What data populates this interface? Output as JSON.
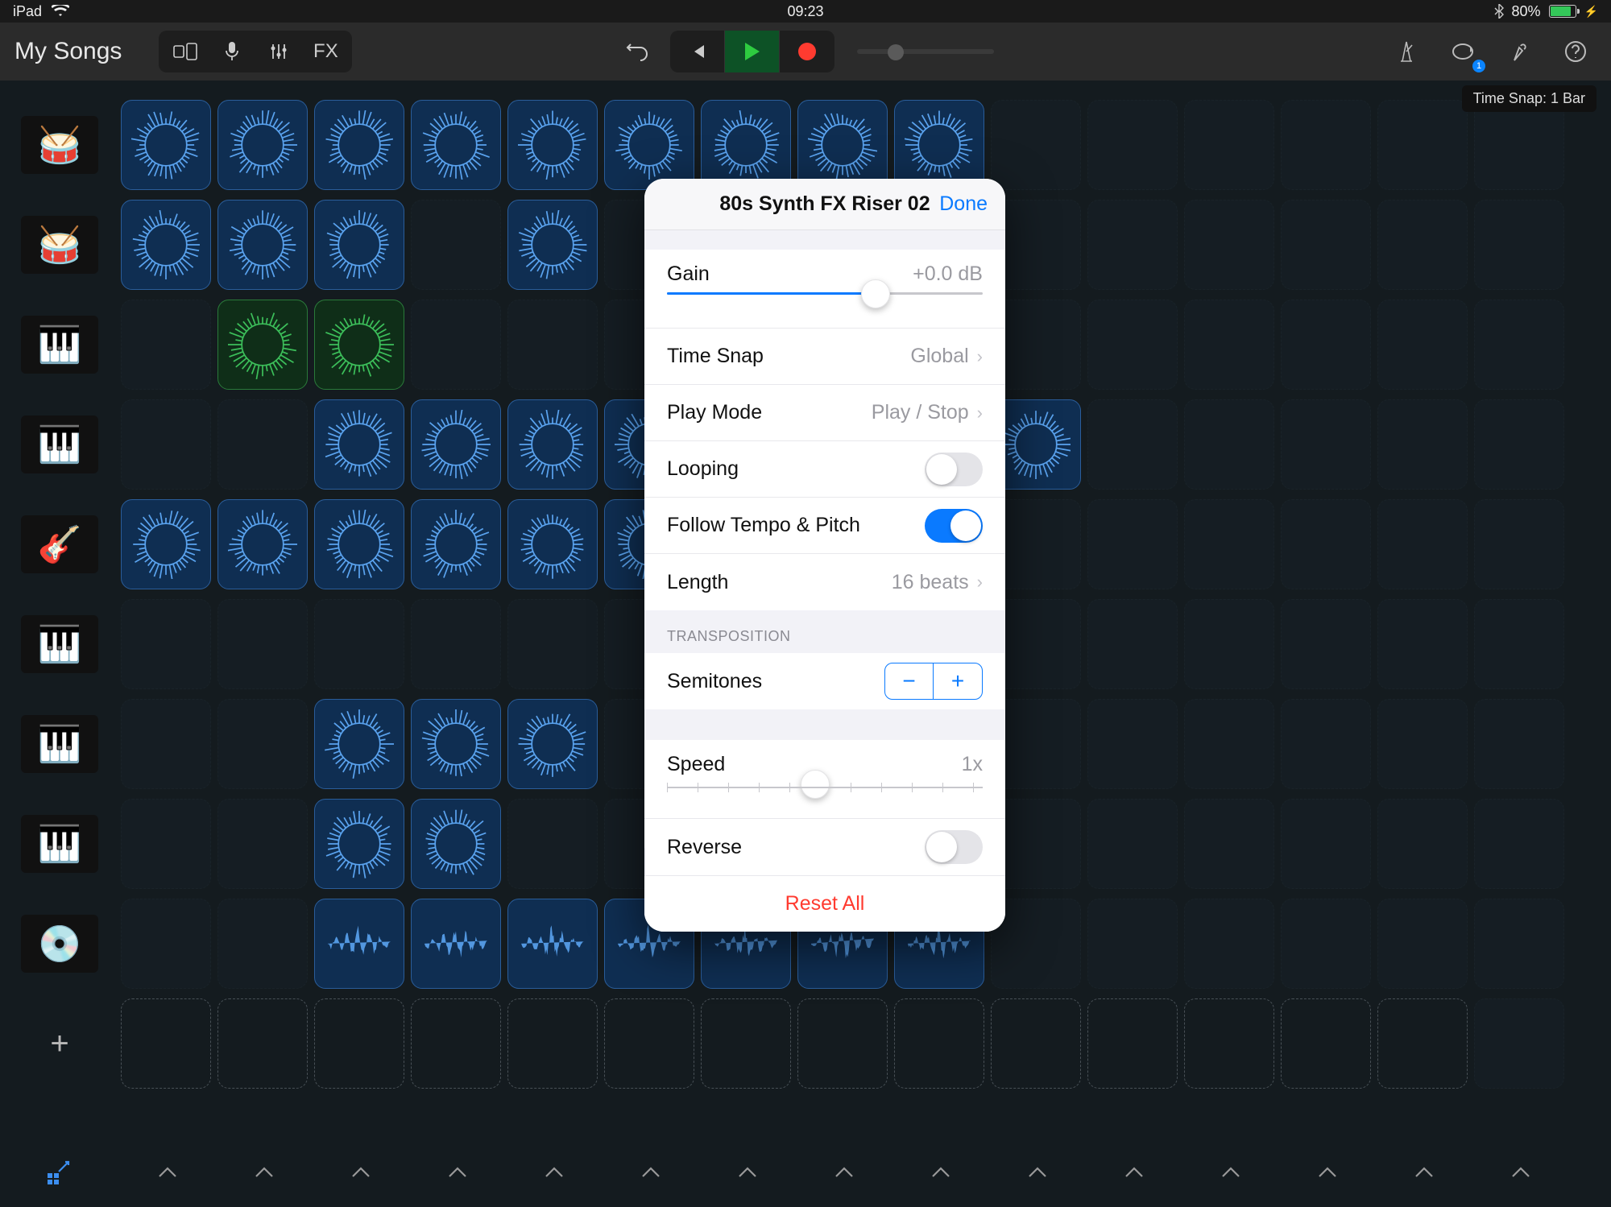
{
  "statusbar": {
    "device": "iPad",
    "time": "09:23",
    "battery_pct": "80%",
    "battery_fill": 80
  },
  "toolbar": {
    "back_label": "My Songs",
    "fx_label": "FX",
    "loop_badge": "1"
  },
  "tooltip": "Time Snap: 1 Bar",
  "popover": {
    "title": "80s Synth FX Riser 02",
    "done": "Done",
    "gain": {
      "label": "Gain",
      "value": "+0.0 dB",
      "pct": 66
    },
    "time_snap": {
      "label": "Time Snap",
      "value": "Global"
    },
    "play_mode": {
      "label": "Play Mode",
      "value": "Play / Stop"
    },
    "looping": {
      "label": "Looping",
      "on": false
    },
    "follow": {
      "label": "Follow Tempo & Pitch",
      "on": true
    },
    "length": {
      "label": "Length",
      "value": "16 beats"
    },
    "transposition_header": "TRANSPOSITION",
    "semitones": {
      "label": "Semitones"
    },
    "speed": {
      "label": "Speed",
      "value": "1x",
      "pct": 47
    },
    "reverse": {
      "label": "Reverse",
      "on": false
    },
    "reset": "Reset All"
  },
  "tracks": [
    {
      "inst": "drums-blue",
      "cells": [
        "b",
        "b",
        "b",
        "b",
        "b",
        "b",
        "b",
        "b",
        "b"
      ]
    },
    {
      "inst": "drums-blue",
      "cells": [
        "b",
        "b",
        "b",
        "",
        "b",
        "",
        "b"
      ]
    },
    {
      "inst": "synth",
      "cells": [
        "",
        "g",
        "g"
      ]
    },
    {
      "inst": "synth",
      "cells": [
        "",
        "",
        "b",
        "b",
        "b",
        "b",
        "b",
        "b",
        "",
        "b"
      ]
    },
    {
      "inst": "guitar",
      "cells": [
        "b",
        "b",
        "b",
        "b",
        "b",
        "b"
      ]
    },
    {
      "inst": "keys-red",
      "cells": [
        "",
        "",
        "",
        "",
        "",
        "",
        "",
        "",
        "t"
      ]
    },
    {
      "inst": "keys-red",
      "cells": [
        "",
        "",
        "b",
        "b",
        "b"
      ]
    },
    {
      "inst": "keys-black",
      "cells": [
        "",
        "",
        "b",
        "b"
      ]
    },
    {
      "inst": "turntable",
      "cells": [
        "",
        "",
        "b",
        "b",
        "b",
        "b",
        "b",
        "b",
        "b"
      ]
    },
    {
      "inst": "add",
      "cells": [
        "d",
        "d",
        "d",
        "d",
        "d",
        "d",
        "d",
        "d",
        "d",
        "d",
        "d",
        "d",
        "d",
        "d"
      ]
    }
  ],
  "instrument_glyphs": {
    "drums-blue": "🥁",
    "synth": "🎹",
    "guitar": "🎸",
    "keys-red": "🎹",
    "keys-black": "🎹",
    "turntable": "💿"
  }
}
